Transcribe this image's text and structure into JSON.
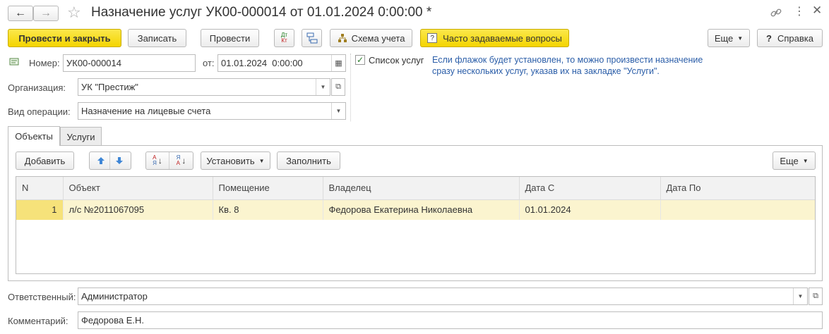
{
  "window": {
    "title": "Назначение услуг УК00-000014 от 01.01.2024 0:00:00 *"
  },
  "toolbar": {
    "post_close_label": "Провести и закрыть",
    "save_label": "Записать",
    "post_label": "Провести",
    "dt_kt_label": "Дт Кт",
    "scheme_label": "Схема учета",
    "faq_label": "Часто задаваемые вопросы",
    "more_label": "Еще",
    "help_label": "Справка"
  },
  "form": {
    "number_label": "Номер:",
    "number_value": "УК00-000014",
    "date_label": "от:",
    "date_value": "01.01.2024  0:00:00",
    "org_label": "Организация:",
    "org_value": "УК \"Престиж\"",
    "op_label": "Вид операции:",
    "op_value": "Назначение на лицевые счета",
    "services_list_label": "Список услуг",
    "services_list_checked": true,
    "hint_line1": "Если флажок будет установлен, то можно произвести назначение",
    "hint_line2": "сразу нескольких услуг, указав их на закладке \"Услуги\".",
    "responsible_label": "Ответственный:",
    "responsible_value": "Администратор",
    "comment_label": "Комментарий:",
    "comment_value": "Федорова Е.Н."
  },
  "tabs": [
    {
      "label": "Объекты",
      "active": true
    },
    {
      "label": "Услуги",
      "active": false
    }
  ],
  "table_toolbar": {
    "add_label": "Добавить",
    "set_label": "Установить",
    "fill_label": "Заполнить",
    "more_label": "Еще"
  },
  "table": {
    "columns": [
      "N",
      "Объект",
      "Помещение",
      "Владелец",
      "Дата С",
      "Дата По"
    ],
    "rows": [
      {
        "n": "1",
        "object": "л/с №2011067095",
        "room": "Кв. 8",
        "owner": "Федорова Екатерина Николаевна",
        "date_from": "01.01.2024",
        "date_to": ""
      }
    ]
  },
  "colors": {
    "accent_yellow": "#f4d400",
    "row_highlight": "#fbf4cf",
    "hint_blue": "#2a5da8"
  }
}
